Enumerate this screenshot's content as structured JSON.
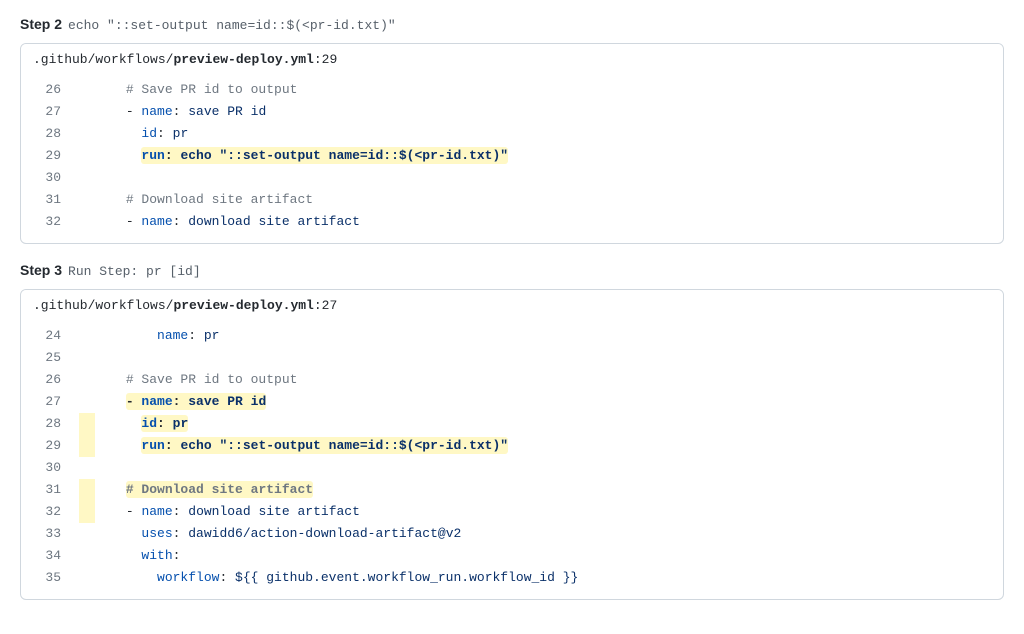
{
  "steps": [
    {
      "label": "Step 2",
      "desc": "echo \"::set-output name=id::$(<pr-id.txt)\"",
      "file_prefix": ".github/workflows/",
      "file_name": "preview-deploy.yml",
      "file_line": ":29",
      "lines": [
        {
          "n": "26",
          "indent": "      ",
          "segs": [
            {
              "cls": "t-comment",
              "t": "# Save PR id to output"
            }
          ]
        },
        {
          "n": "27",
          "indent": "      ",
          "segs": [
            {
              "cls": "t-dash",
              "t": "- "
            },
            {
              "cls": "t-key",
              "t": "name"
            },
            {
              "cls": "t-colon",
              "t": ": "
            },
            {
              "cls": "t-string",
              "t": "save PR id"
            }
          ]
        },
        {
          "n": "28",
          "indent": "        ",
          "segs": [
            {
              "cls": "t-key",
              "t": "id"
            },
            {
              "cls": "t-colon",
              "t": ": "
            },
            {
              "cls": "t-string",
              "t": "pr"
            }
          ]
        },
        {
          "n": "29",
          "indent": "        ",
          "hl": true,
          "segs": [
            {
              "cls": "t-key t-bold",
              "t": "run"
            },
            {
              "cls": "t-colon t-bold",
              "t": ": "
            },
            {
              "cls": "t-string t-bold",
              "t": "echo \"::set-output name=id::$(<pr-id.txt)\""
            }
          ]
        },
        {
          "n": "30",
          "indent": "",
          "segs": []
        },
        {
          "n": "31",
          "indent": "      ",
          "segs": [
            {
              "cls": "t-comment",
              "t": "# Download site artifact"
            }
          ]
        },
        {
          "n": "32",
          "indent": "      ",
          "segs": [
            {
              "cls": "t-dash",
              "t": "- "
            },
            {
              "cls": "t-key",
              "t": "name"
            },
            {
              "cls": "t-colon",
              "t": ": "
            },
            {
              "cls": "t-string",
              "t": "download site artifact"
            }
          ]
        }
      ]
    },
    {
      "label": "Step 3",
      "desc": "Run Step: pr [id]",
      "file_prefix": ".github/workflows/",
      "file_name": "preview-deploy.yml",
      "file_line": ":27",
      "lines": [
        {
          "n": "24",
          "indent": "          ",
          "segs": [
            {
              "cls": "t-key",
              "t": "name"
            },
            {
              "cls": "t-colon",
              "t": ": "
            },
            {
              "cls": "t-string",
              "t": "pr"
            }
          ]
        },
        {
          "n": "25",
          "indent": "",
          "segs": []
        },
        {
          "n": "26",
          "indent": "      ",
          "segs": [
            {
              "cls": "t-comment",
              "t": "# Save PR id to output"
            }
          ]
        },
        {
          "n": "27",
          "indent": "      ",
          "hl": true,
          "segs": [
            {
              "cls": "t-dash t-bold",
              "t": "- "
            },
            {
              "cls": "t-key t-bold",
              "t": "name"
            },
            {
              "cls": "t-colon t-bold",
              "t": ": "
            },
            {
              "cls": "t-string t-bold",
              "t": "save PR id"
            }
          ]
        },
        {
          "n": "28",
          "indent": "        ",
          "hl": true,
          "hlpre": true,
          "segs": [
            {
              "cls": "t-key t-bold",
              "t": "id"
            },
            {
              "cls": "t-colon t-bold",
              "t": ": "
            },
            {
              "cls": "t-string t-bold",
              "t": "pr"
            }
          ]
        },
        {
          "n": "29",
          "indent": "        ",
          "hl": true,
          "hlpre": true,
          "segs": [
            {
              "cls": "t-key t-bold",
              "t": "run"
            },
            {
              "cls": "t-colon t-bold",
              "t": ": "
            },
            {
              "cls": "t-string t-bold",
              "t": "echo \"::set-output name=id::$(<pr-id.txt)\""
            }
          ]
        },
        {
          "n": "30",
          "indent": "",
          "segs": []
        },
        {
          "n": "31",
          "indent": "      ",
          "hl": true,
          "hlpre": true,
          "segs": [
            {
              "cls": "t-comment t-bold",
              "t": "# Download site artifact"
            }
          ]
        },
        {
          "n": "32",
          "indent": "      ",
          "hlpre": true,
          "segs": [
            {
              "cls": "t-dash",
              "t": "- "
            },
            {
              "cls": "t-key",
              "t": "name"
            },
            {
              "cls": "t-colon",
              "t": ": "
            },
            {
              "cls": "t-string",
              "t": "download site artifact"
            }
          ]
        },
        {
          "n": "33",
          "indent": "        ",
          "segs": [
            {
              "cls": "t-key",
              "t": "uses"
            },
            {
              "cls": "t-colon",
              "t": ": "
            },
            {
              "cls": "t-string",
              "t": "dawidd6/action-download-artifact@v2"
            }
          ]
        },
        {
          "n": "34",
          "indent": "        ",
          "segs": [
            {
              "cls": "t-key",
              "t": "with"
            },
            {
              "cls": "t-colon",
              "t": ":"
            }
          ]
        },
        {
          "n": "35",
          "indent": "          ",
          "segs": [
            {
              "cls": "t-key",
              "t": "workflow"
            },
            {
              "cls": "t-colon",
              "t": ": "
            },
            {
              "cls": "t-string",
              "t": "${{ github.event.workflow_run.workflow_id }}"
            }
          ]
        }
      ]
    }
  ]
}
